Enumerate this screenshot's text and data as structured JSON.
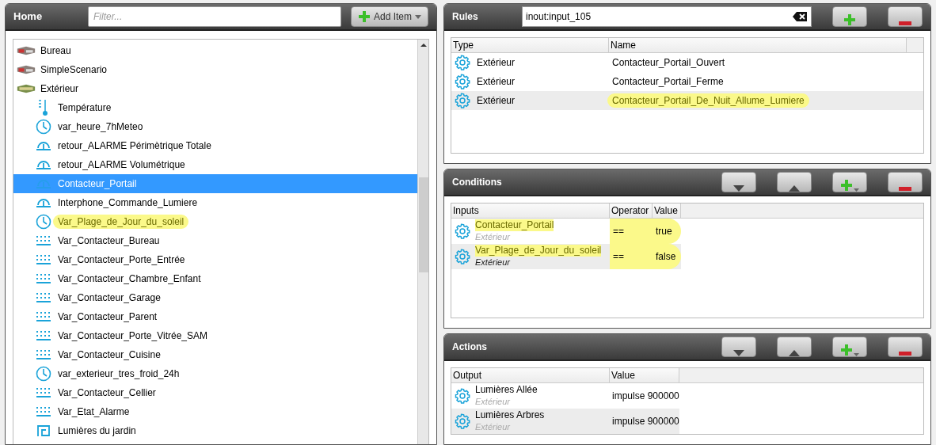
{
  "home": {
    "title": "Home",
    "filter": {
      "placeholder": "Filter..."
    },
    "add_button": "Add Item",
    "tree": [
      {
        "label": "Bureau",
        "kind": "room",
        "selected": false,
        "highlighted": false
      },
      {
        "label": "SimpleScenario",
        "kind": "room",
        "selected": false,
        "highlighted": false
      },
      {
        "label": "Extérieur",
        "kind": "garden",
        "selected": false,
        "highlighted": false,
        "children": [
          {
            "label": "Température",
            "kind": "thermometer",
            "selected": false,
            "highlighted": false
          },
          {
            "label": "var_heure_7hMeteo",
            "kind": "clock",
            "selected": false,
            "highlighted": false
          },
          {
            "label": "retour_ALARME Périmètrique Totale",
            "kind": "sensor",
            "selected": false,
            "highlighted": false
          },
          {
            "label": "retour_ALARME Volumétrique",
            "kind": "sensor",
            "selected": false,
            "highlighted": false
          },
          {
            "label": "Contacteur_Portail",
            "kind": "sensor",
            "selected": true,
            "highlighted": false
          },
          {
            "label": "Interphone_Commande_Lumiere",
            "kind": "sensor",
            "selected": false,
            "highlighted": false
          },
          {
            "label": "Var_Plage_de_Jour_du_soleil",
            "kind": "clock",
            "selected": false,
            "highlighted": true
          },
          {
            "label": "Var_Contacteur_Bureau",
            "kind": "dots",
            "selected": false,
            "highlighted": false
          },
          {
            "label": "Var_Contacteur_Porte_Entrée",
            "kind": "dots",
            "selected": false,
            "highlighted": false
          },
          {
            "label": "Var_Contacteur_Chambre_Enfant",
            "kind": "dots",
            "selected": false,
            "highlighted": false
          },
          {
            "label": "Var_Contacteur_Garage",
            "kind": "dots",
            "selected": false,
            "highlighted": false
          },
          {
            "label": "Var_Contacteur_Parent",
            "kind": "dots",
            "selected": false,
            "highlighted": false
          },
          {
            "label": "Var_Contacteur_Porte_Vitrée_SAM",
            "kind": "dots",
            "selected": false,
            "highlighted": false
          },
          {
            "label": "Var_Contacteur_Cuisine",
            "kind": "dots",
            "selected": false,
            "highlighted": false
          },
          {
            "label": "var_exterieur_tres_froid_24h",
            "kind": "clock",
            "selected": false,
            "highlighted": false
          },
          {
            "label": "Var_Contacteur_Cellier",
            "kind": "dots",
            "selected": false,
            "highlighted": false
          },
          {
            "label": "Var_Etat_Alarme",
            "kind": "dots",
            "selected": false,
            "highlighted": false
          },
          {
            "label": "Lumières du jardin",
            "kind": "switch",
            "selected": false,
            "highlighted": false
          }
        ]
      }
    ]
  },
  "rules": {
    "title": "Rules",
    "search": "inout:input_105",
    "columns": [
      "Type",
      "Name"
    ],
    "rows": [
      {
        "type": "Extérieur",
        "name": "Contacteur_Portail_Ouvert",
        "selected": false,
        "highlighted": false
      },
      {
        "type": "Extérieur",
        "name": "Contacteur_Portail_Ferme",
        "selected": false,
        "highlighted": false
      },
      {
        "type": "Extérieur",
        "name": "Contacteur_Portail_De_Nuit_Allume_Lumiere",
        "selected": true,
        "highlighted": true
      }
    ]
  },
  "conditions": {
    "title": "Conditions",
    "columns": [
      "Inputs",
      "Operator",
      "Value"
    ],
    "rows": [
      {
        "input": "Contacteur_Portail",
        "location": "Extérieur",
        "operator": "==",
        "value": "true",
        "selected": false,
        "highlighted": true
      },
      {
        "input": "Var_Plage_de_Jour_du_soleil",
        "location": "Extérieur",
        "operator": "==",
        "value": "false",
        "selected": true,
        "highlighted": true
      }
    ]
  },
  "actions": {
    "title": "Actions",
    "columns": [
      "Output",
      "Value"
    ],
    "rows": [
      {
        "output": "Lumières Allée",
        "location": "Extérieur",
        "value": "impulse 900000",
        "selected": false
      },
      {
        "output": "Lumières Arbres",
        "location": "Extérieur",
        "value": "impulse 900000",
        "selected": true
      }
    ]
  }
}
